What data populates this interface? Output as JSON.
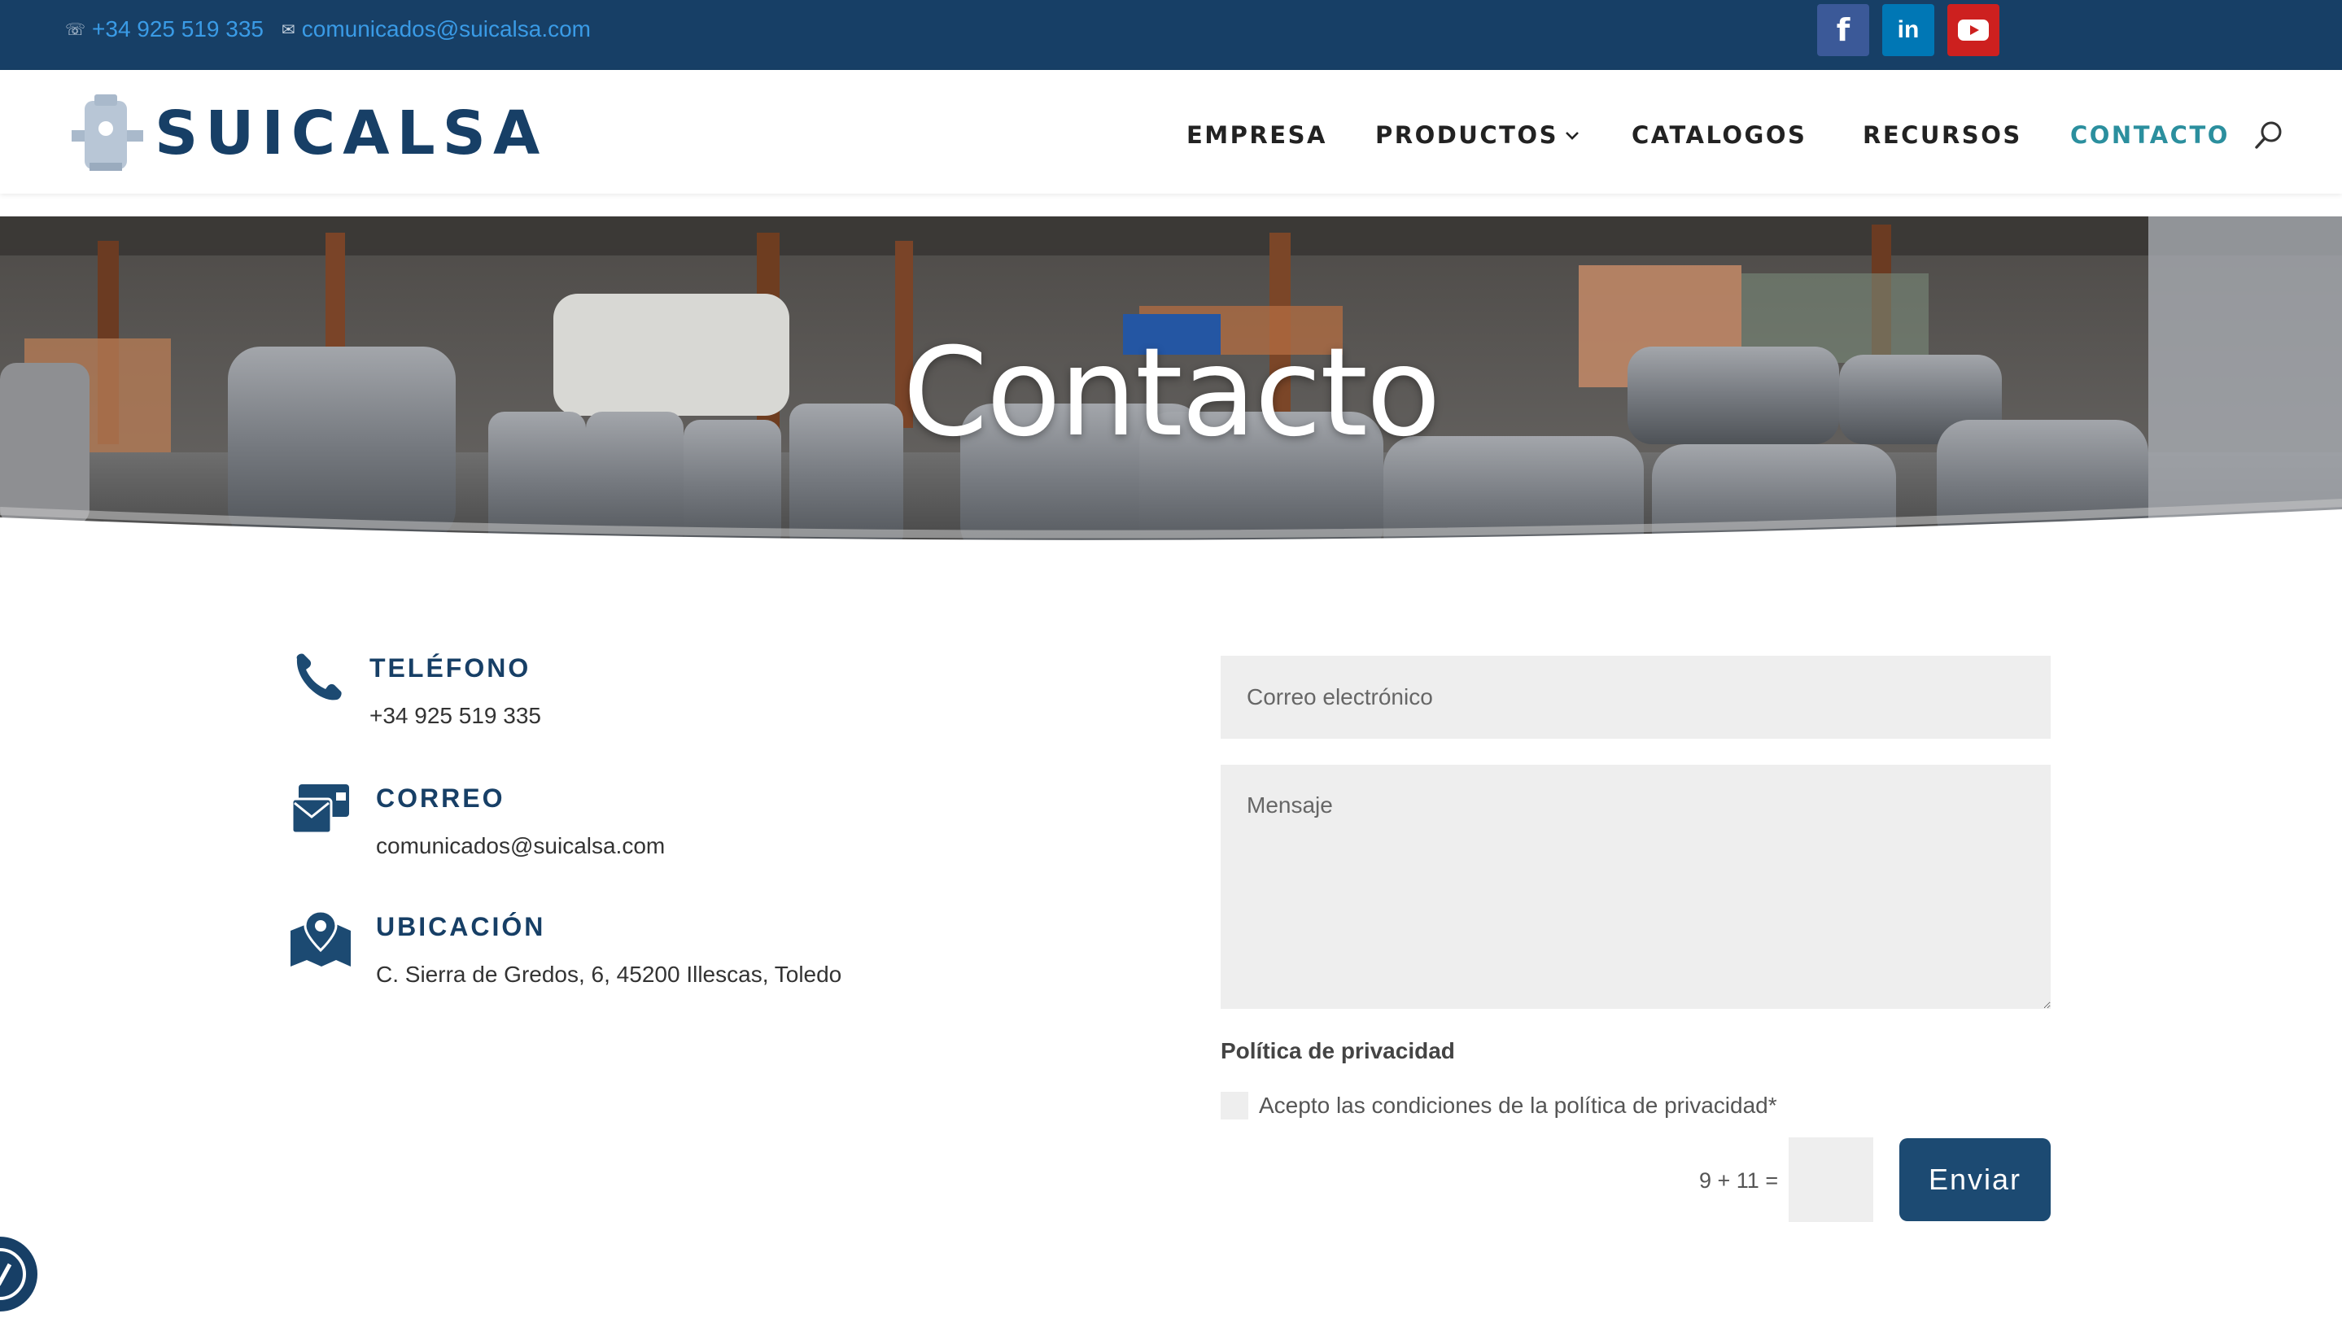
{
  "topbar": {
    "phone": "+34 925 519 335",
    "email": "comunicados@suicalsa.com",
    "social": {
      "facebook_icon": "f",
      "linkedin_icon": "in",
      "youtube_icon": "youtube-icon"
    }
  },
  "header": {
    "logo_text": "SUICALSA",
    "nav": [
      {
        "label": "EMPRESA"
      },
      {
        "label": "PRODUCTOS"
      },
      {
        "label": "CATALOGOS"
      },
      {
        "label": "RECURSOS"
      },
      {
        "label": "CONTACTO"
      }
    ]
  },
  "hero": {
    "title": "Contacto"
  },
  "info": {
    "phone": {
      "title": "TELÉFONO",
      "value": "+34 925 519 335"
    },
    "mail": {
      "title": "CORREO",
      "value": "comunicados@suicalsa.com"
    },
    "location": {
      "title": "UBICACIÓN",
      "value": "C. Sierra de Gredos, 6, 45200 Illescas, Toledo"
    }
  },
  "form": {
    "email_placeholder": "Correo electrónico",
    "message_placeholder": "Mensaje",
    "privacy_title": "Política de privacidad",
    "privacy_checkbox": "Acepto las condiciones de la política de privacidad*",
    "captcha_question": "9 + 11 =",
    "submit_label": "Enviar"
  },
  "colors": {
    "topbar": "#173f66",
    "brand": "#173f66",
    "link": "#3a9be6",
    "nav_active": "#2b8f9e",
    "button": "#1c4a72",
    "field_bg": "#eeeeee"
  }
}
